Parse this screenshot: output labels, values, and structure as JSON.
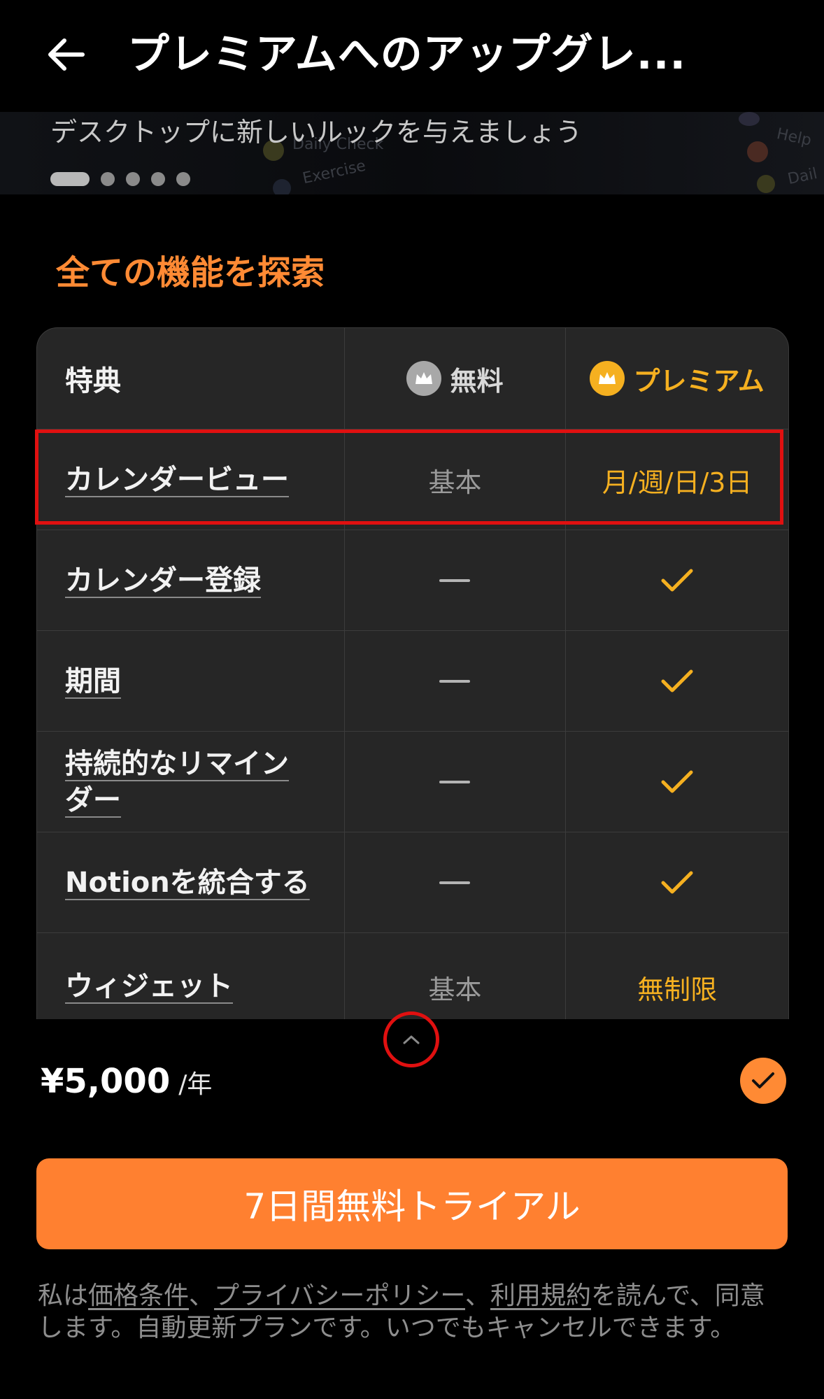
{
  "header": {
    "title": "プレミアムへのアップグレ..."
  },
  "banner": {
    "subtitle": "デスクトップに新しいルックを与えましょう",
    "ghost_items": [
      "Daily Check",
      "Exercise",
      "Help",
      "Dail"
    ],
    "dots_total": 5,
    "dots_active_index": 0
  },
  "section": {
    "title": "全ての機能を探索"
  },
  "table": {
    "header": {
      "feature": "特典",
      "free": "無料",
      "premium": "プレミアム"
    },
    "rows": [
      {
        "feature": "カレンダービュー",
        "free": "基本",
        "premium": "月/週/日/3日"
      },
      {
        "feature": "カレンダー登録",
        "free": "—",
        "premium": "✓"
      },
      {
        "feature": "期間",
        "free": "—",
        "premium": "✓"
      },
      {
        "feature": "持続的なリマインダー",
        "feature_line1": "持続的なリマイン",
        "feature_line2": "ダー",
        "free": "—",
        "premium": "✓"
      },
      {
        "feature": "Notionを統合する",
        "free": "—",
        "premium": "✓"
      },
      {
        "feature": "ウィジェット",
        "free": "基本",
        "premium": "無制限"
      }
    ]
  },
  "plan": {
    "price": "¥5,000",
    "period": "/年",
    "selected": true
  },
  "cta": {
    "label": "7日間無料トライアル"
  },
  "legal": {
    "prefix": "私は",
    "link1": "価格条件",
    "sep1": "、",
    "link2": "プライバシーポリシー",
    "sep2": "、",
    "link3": "利用規約",
    "suffix": "を読んで、同意します。自動更新プランです。いつでもキャンセルできます。"
  },
  "colors": {
    "accent": "#ff8a34",
    "premium_gold": "#f5b020",
    "annotation_red": "#e01010",
    "background": "#000000",
    "table_bg": "#262626"
  }
}
